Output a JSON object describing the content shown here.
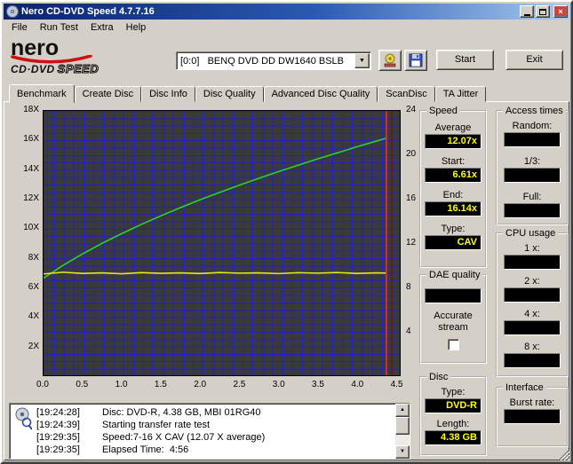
{
  "window": {
    "title": "Nero CD-DVD Speed 4.7.7.16"
  },
  "menu": {
    "items": [
      "File",
      "Run Test",
      "Extra",
      "Help"
    ]
  },
  "logo": {
    "brand": "nero",
    "product_prefix": "CD·DVD",
    "product_suffix": "SPEED"
  },
  "toolbar": {
    "drive_selector": "[0:0]   BENQ DVD DD DW1640 BSLB",
    "start_button": "Start",
    "exit_button": "Exit"
  },
  "tabs": {
    "active": "Benchmark",
    "items": [
      "Benchmark",
      "Create Disc",
      "Disc Info",
      "Disc Quality",
      "Advanced Disc Quality",
      "ScanDisc",
      "TA Jitter"
    ]
  },
  "chart_data": {
    "type": "line",
    "x_range": [
      0,
      4.55
    ],
    "x_ticks": [
      "0.0",
      "0.5",
      "1.0",
      "1.5",
      "2.0",
      "2.5",
      "3.0",
      "3.5",
      "4.0",
      "4.5"
    ],
    "left_axis": {
      "range": [
        0,
        18
      ],
      "ticks": [
        "18X",
        "16X",
        "14X",
        "12X",
        "10X",
        "8X",
        "6X",
        "4X",
        "2X"
      ]
    },
    "right_axis": {
      "range": [
        0,
        24
      ],
      "ticks": [
        "24",
        "20",
        "16",
        "12",
        "8",
        "4"
      ]
    },
    "grid": true,
    "plot_bg": "#3a3a3a",
    "grid_color": "#2121bd",
    "series": [
      {
        "name": "read-speed",
        "color": "#2bd42b",
        "axis": "left",
        "width": 1.6,
        "x": [
          0,
          0.25,
          0.5,
          0.75,
          1.0,
          1.25,
          1.5,
          1.75,
          2.0,
          2.25,
          2.5,
          2.75,
          3.0,
          3.25,
          3.5,
          3.75,
          4.0,
          4.25,
          4.38
        ],
        "y": [
          6.61,
          7.49,
          8.27,
          8.99,
          9.65,
          10.27,
          10.86,
          11.42,
          11.95,
          12.45,
          12.94,
          13.41,
          13.86,
          14.3,
          14.73,
          15.14,
          15.55,
          15.94,
          16.14
        ]
      },
      {
        "name": "rotation-speed",
        "color": "#e8e821",
        "axis": "right",
        "width": 1.6,
        "x": [
          0,
          0.25,
          0.5,
          0.75,
          1.0,
          1.25,
          1.5,
          1.75,
          2.0,
          2.25,
          2.5,
          2.75,
          3.0,
          3.25,
          3.5,
          3.75,
          4.0,
          4.25,
          4.38
        ],
        "y": [
          9.2,
          9.35,
          9.25,
          9.3,
          9.22,
          9.32,
          9.26,
          9.3,
          9.24,
          9.33,
          9.27,
          9.3,
          9.23,
          9.31,
          9.27,
          9.33,
          9.25,
          9.3,
          9.28
        ]
      },
      {
        "name": "end-marker",
        "color": "#e83021",
        "axis": "left",
        "width": 1.6,
        "x": [
          4.38,
          4.38
        ],
        "y": [
          0,
          18
        ]
      },
      {
        "name": "end-marker-shadow",
        "color": "#7a1010",
        "axis": "left",
        "width": 1.6,
        "x": [
          4.45,
          4.45
        ],
        "y": [
          0,
          18
        ]
      }
    ]
  },
  "panels": {
    "speed": {
      "title": "Speed",
      "rows": [
        {
          "label": "Average",
          "value": "12.07x"
        },
        {
          "label": "Start:",
          "value": "6.61x"
        },
        {
          "label": "End:",
          "value": "16.14x"
        },
        {
          "label": "Type:",
          "value": "CAV"
        }
      ]
    },
    "access_times": {
      "title": "Access times",
      "rows": [
        {
          "label": "Random:",
          "value": ""
        },
        {
          "label": "1/3:",
          "value": ""
        },
        {
          "label": "Full:",
          "value": ""
        }
      ]
    },
    "cpu_usage": {
      "title": "CPU usage",
      "rows": [
        {
          "label": "1 x:",
          "value": ""
        },
        {
          "label": "2 x:",
          "value": ""
        },
        {
          "label": "4 x:",
          "value": ""
        },
        {
          "label": "8 x:",
          "value": ""
        }
      ]
    },
    "dae_quality": {
      "title": "DAE quality",
      "value": "",
      "checkbox_label": "Accurate stream",
      "checked": false
    },
    "disc": {
      "title": "Disc",
      "rows": [
        {
          "label": "Type:",
          "value": "DVD-R"
        },
        {
          "label": "Length:",
          "value": "4.38 GB"
        }
      ]
    },
    "interface": {
      "title": "Interface",
      "rows": [
        {
          "label": "Burst rate:",
          "value": ""
        }
      ]
    }
  },
  "log": {
    "lines": [
      {
        "time": "[19:24:28]",
        "text": "Disc: DVD-R, 4.38 GB, MBI 01RG40"
      },
      {
        "time": "[19:24:39]",
        "text": "Starting transfer rate test"
      },
      {
        "time": "[19:29:35]",
        "text": "Speed:7-16 X CAV (12.07 X average)"
      },
      {
        "time": "[19:29:35]",
        "text": "Elapsed Time:  4:56"
      }
    ]
  },
  "colors": {
    "value_text": "#ffff00",
    "value_bg": "#000000",
    "titlebar": "#0a246a"
  }
}
